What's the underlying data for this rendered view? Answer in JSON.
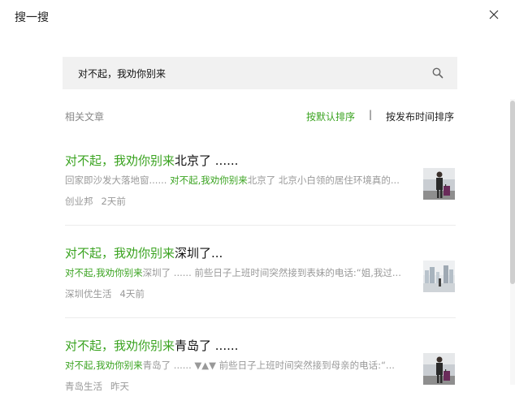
{
  "window": {
    "title": "搜一搜"
  },
  "search": {
    "value": "对不起，我劝你别来"
  },
  "section": {
    "label": "相关文章"
  },
  "sort": {
    "default_label": "按默认排序",
    "divider": "|",
    "time_label": "按发布时间排序"
  },
  "colors": {
    "accent": "#3aa320",
    "muted": "#999999",
    "search_bg": "#f1f1f1"
  },
  "results": [
    {
      "title_hl": "对不起，我劝你别来",
      "title_rest": "北京了 ......",
      "snippet_pre": "回家即沙发大落地窗...... ",
      "snippet_hl": "对不起,我劝你别来",
      "snippet_post": "北京了 北京小白领的居住环境真的...",
      "source": "创业邦",
      "time": "2天前",
      "thumb_icon": "person-with-luggage-thumbnail"
    },
    {
      "title_hl": "对不起，我劝你别来",
      "title_rest": "深圳了...",
      "snippet_pre": "",
      "snippet_hl": "对不起,我劝你别来",
      "snippet_post": "深圳了 ...... 前些日子上班时间突然接到表妹的电话:“姐,我过...",
      "source": "深圳优生活",
      "time": "4天前",
      "thumb_icon": "city-buildings-thumbnail"
    },
    {
      "title_hl": "对不起，我劝你别来",
      "title_rest": "青岛了 ......",
      "snippet_pre": "",
      "snippet_hl": "对不起,我劝你别来",
      "snippet_post": "青岛了 ...... ▼▲▼ 前些日子上班时间突然接到母亲的电话:“...",
      "source": "青岛生活",
      "time": "昨天",
      "thumb_icon": "person-with-luggage-thumbnail"
    }
  ]
}
